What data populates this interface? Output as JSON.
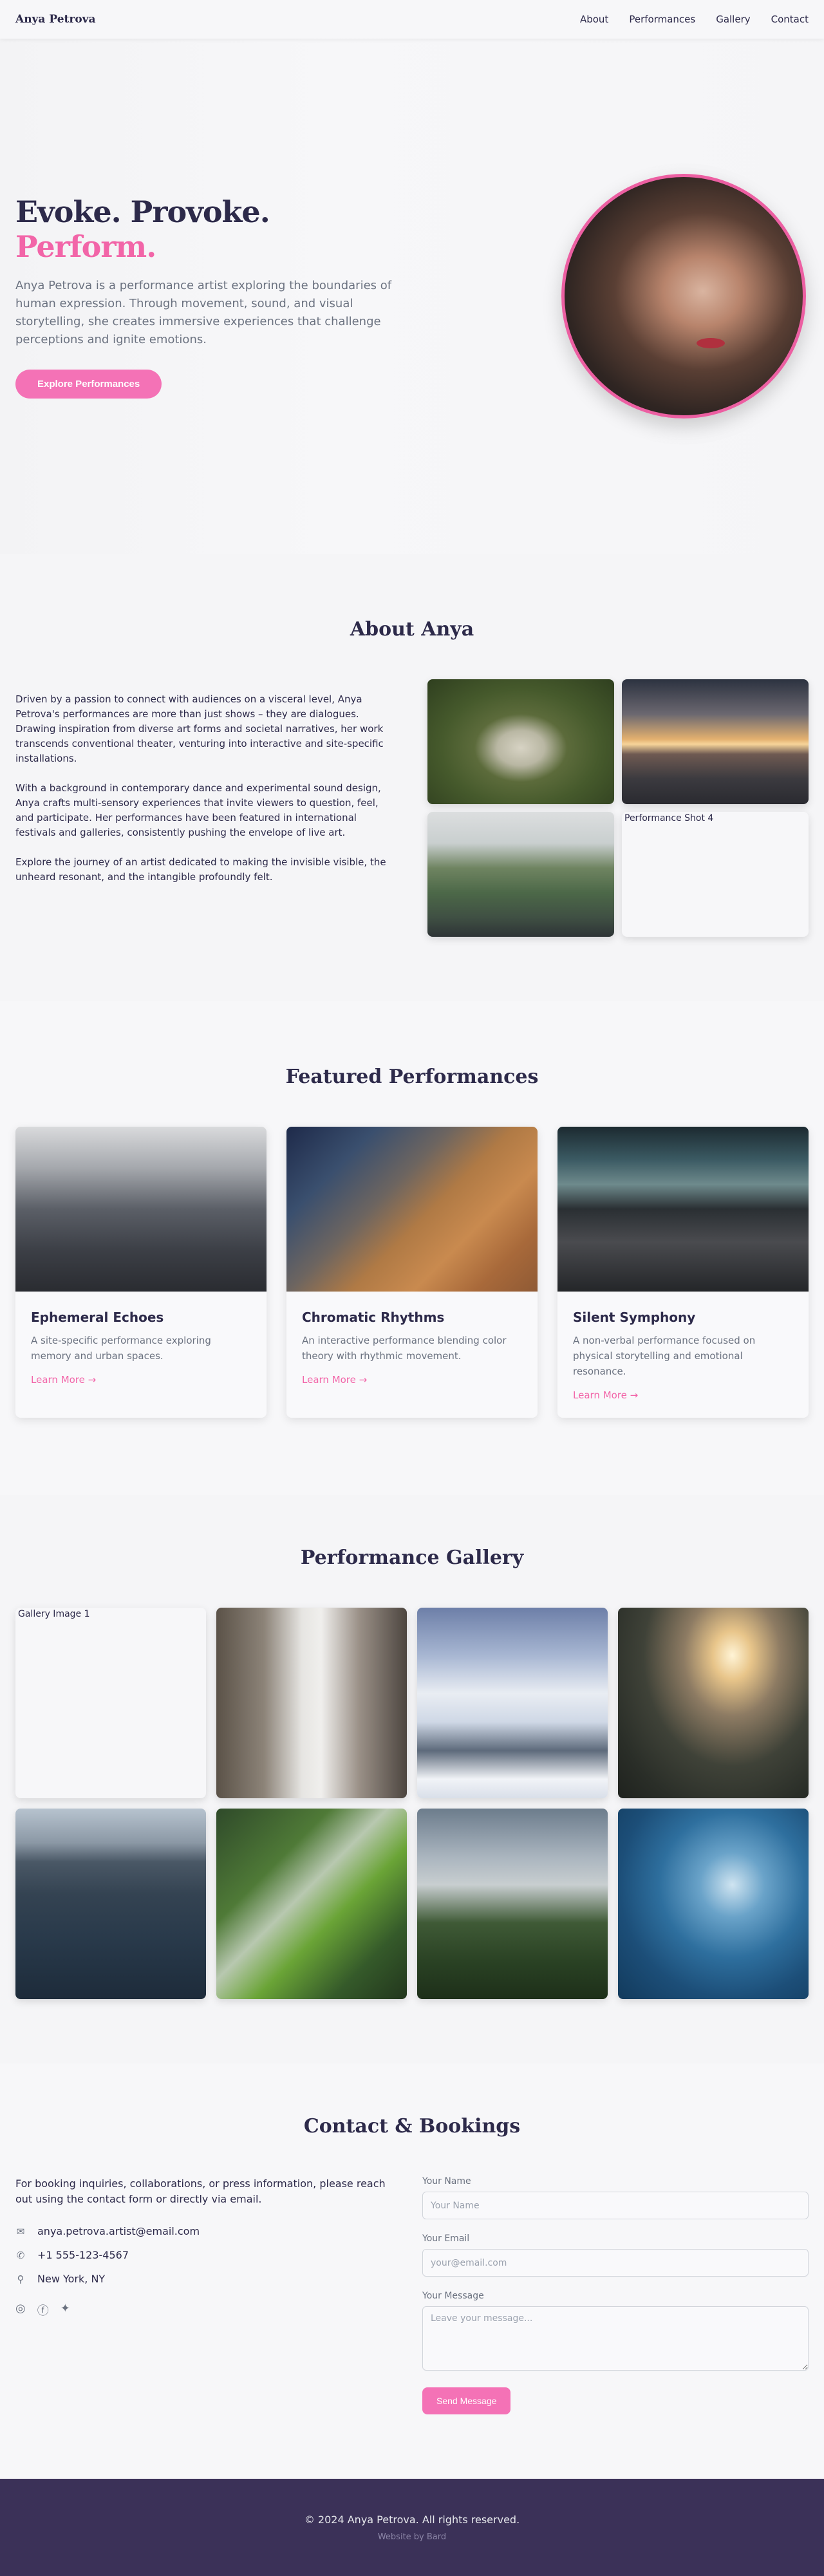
{
  "nav": {
    "brand": "Anya Petrova",
    "links": [
      "About",
      "Performances",
      "Gallery",
      "Contact"
    ]
  },
  "hero": {
    "title_main": "Evoke. Provoke.",
    "title_accent": "Perform.",
    "description": "Anya Petrova is a performance artist exploring the boundaries of human expression. Through movement, sound, and visual storytelling, she creates immersive experiences that challenge perceptions and ignite emotions.",
    "cta": "Explore Performances"
  },
  "about": {
    "title": "About Anya",
    "paragraphs": [
      "Driven by a passion to connect with audiences on a visceral level, Anya Petrova's performances are more than just shows – they are dialogues. Drawing inspiration from diverse art forms and societal narratives, her work transcends conventional theater, venturing into interactive and site-specific installations.",
      "With a background in contemporary dance and experimental sound design, Anya crafts multi-sensory experiences that invite viewers to question, feel, and participate. Her performances have been featured in international festivals and galleries, consistently pushing the envelope of live art.",
      "Explore the journey of an artist dedicated to making the invisible visible, the unheard resonant, and the intangible profoundly felt."
    ],
    "broken_image_alt": "Performance Shot 4"
  },
  "featured": {
    "title": "Featured Performances",
    "cards": [
      {
        "title": "Ephemeral Echoes",
        "description": "A site-specific performance exploring memory and urban spaces.",
        "link": "Learn More"
      },
      {
        "title": "Chromatic Rhythms",
        "description": "An interactive performance blending color theory with rhythmic movement.",
        "link": "Learn More"
      },
      {
        "title": "Silent Symphony",
        "description": "A non-verbal performance focused on physical storytelling and emotional resonance.",
        "link": "Learn More"
      }
    ]
  },
  "gallery": {
    "title": "Performance Gallery",
    "broken_image_alt": "Gallery Image 1"
  },
  "contact": {
    "title": "Contact & Bookings",
    "intro": "For booking inquiries, collaborations, or press information, please reach out using the contact form or directly via email.",
    "email": "anya.petrova.artist@email.com",
    "phone": "+1 555-123-4567",
    "location": "New York, NY",
    "form": {
      "name_label": "Your Name",
      "name_placeholder": "Your Name",
      "email_label": "Your Email",
      "email_placeholder": "your@email.com",
      "message_label": "Your Message",
      "message_placeholder": "Leave your message...",
      "submit": "Send Message"
    }
  },
  "footer": {
    "copyright": "© 2024 Anya Petrova. All rights reserved.",
    "credit": "Website by Bard"
  },
  "colors": {
    "accent": "#f472b6",
    "text": "#2d2a4a",
    "footer_bg": "#3b3158"
  }
}
